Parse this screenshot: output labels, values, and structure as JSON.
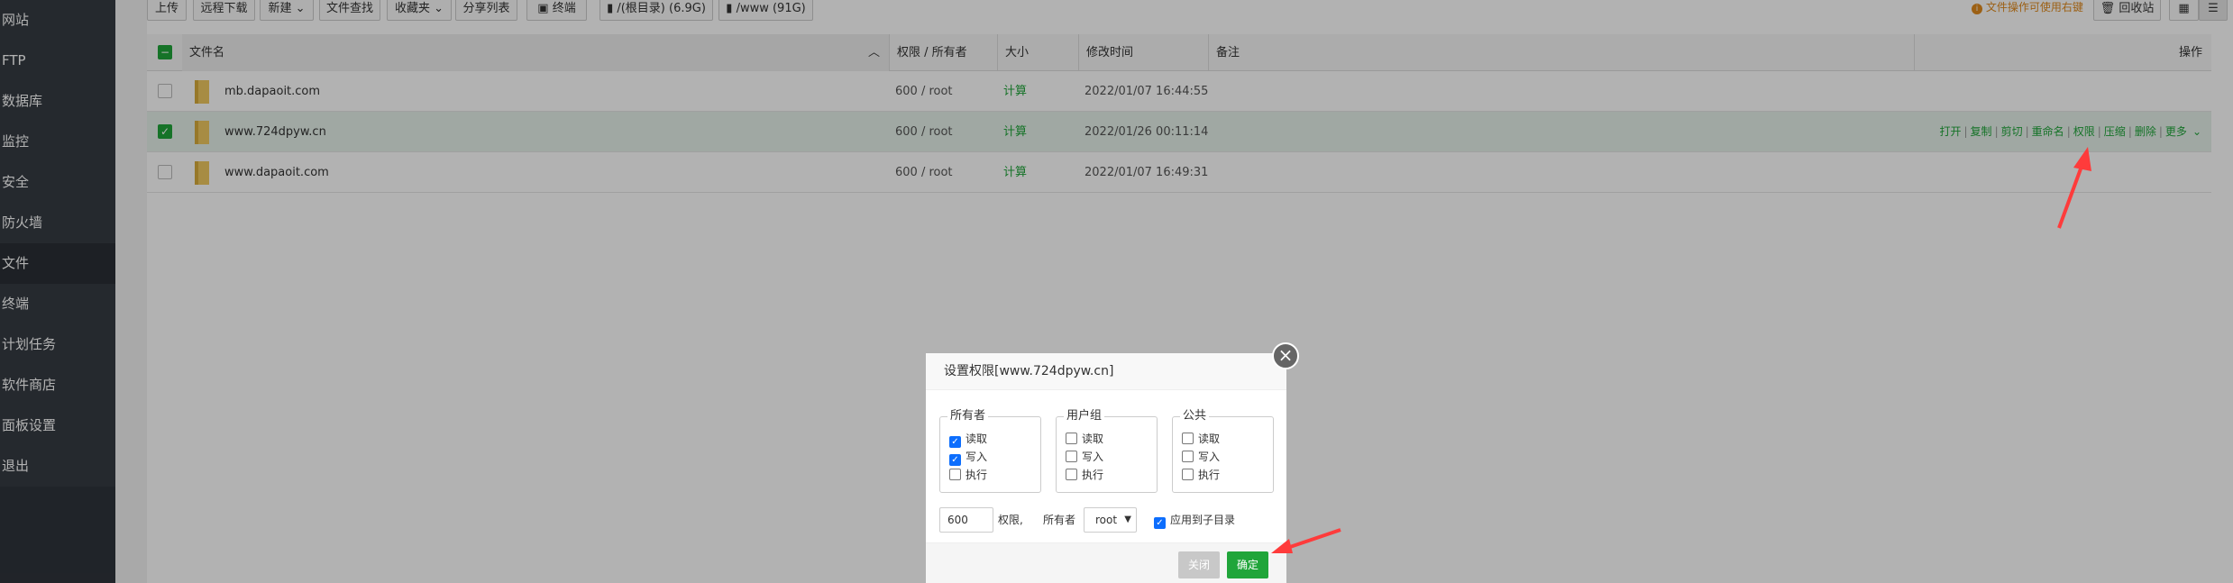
{
  "sidebar": {
    "items": [
      "网站",
      "FTP",
      "数据库",
      "监控",
      "安全",
      "防火墙",
      "文件",
      "终端",
      "计划任务",
      "软件商店",
      "面板设置",
      "退出"
    ],
    "active": "文件"
  },
  "toolbar": {
    "upload": "上传",
    "remote_download": "远程下载",
    "new": "新建",
    "search": "文件查找",
    "favorites": "收藏夹",
    "share_list": "分享列表",
    "terminal": "终端",
    "disk_root": "/(根目录) (6.9G)",
    "disk_www": "/www (91G)",
    "hint": "文件操作可使用右键",
    "recycle": "回收站"
  },
  "table": {
    "headers": {
      "name": "文件名",
      "perm": "权限 / 所有者",
      "size": "大小",
      "mtime": "修改时间",
      "note": "备注",
      "ops": "操作"
    },
    "rows": [
      {
        "name": "mb.dapaoit.com",
        "perm": "600 / root",
        "size": "计算",
        "mtime": "2022/01/07 16:44:55",
        "selected": false
      },
      {
        "name": "www.724dpyw.cn",
        "perm": "600 / root",
        "size": "计算",
        "mtime": "2022/01/26 00:11:14",
        "selected": true
      },
      {
        "name": "www.dapaoit.com",
        "perm": "600 / root",
        "size": "计算",
        "mtime": "2022/01/07 16:49:31",
        "selected": false
      }
    ],
    "row_actions": [
      "打开",
      "复制",
      "剪切",
      "重命名",
      "权限",
      "压缩",
      "删除",
      "更多"
    ]
  },
  "modal": {
    "title": "设置权限[www.724dpyw.cn]",
    "groups": [
      {
        "label": "所有者",
        "read": true,
        "write": true,
        "exec": false
      },
      {
        "label": "用户组",
        "read": false,
        "write": false,
        "exec": false
      },
      {
        "label": "公共",
        "read": false,
        "write": false,
        "exec": false
      }
    ],
    "perm_labels": {
      "read": "读取",
      "write": "写入",
      "exec": "执行"
    },
    "perm_value": "600",
    "perm_suffix": "权限,",
    "owner_label": "所有者",
    "owner_value": "root",
    "apply_sub": "应用到子目录",
    "apply_sub_checked": true,
    "cancel": "关闭",
    "confirm": "确定"
  },
  "colors": {
    "accent": "#20a53a",
    "annotation_arrow": "#ff3b3b"
  }
}
